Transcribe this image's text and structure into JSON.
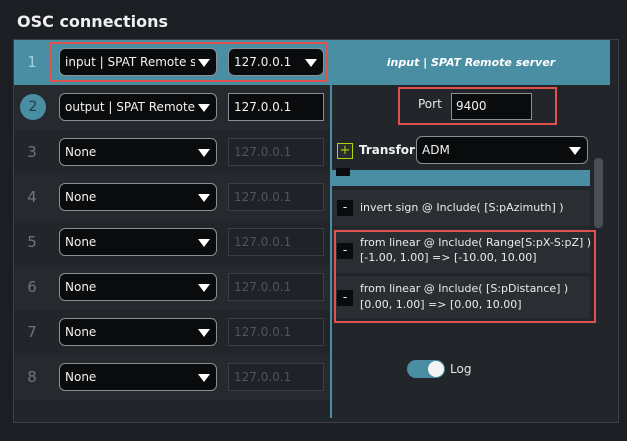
{
  "title": "OSC connections",
  "connections": [
    {
      "num": "1",
      "type": "input | SPAT Remote server",
      "ip": "127.0.0.1",
      "selected": true
    },
    {
      "num": "2",
      "type": "output | SPAT Remote server",
      "ip": "127.0.0.1"
    },
    {
      "num": "3",
      "type": "None",
      "ip": "127.0.0.1"
    },
    {
      "num": "4",
      "type": "None",
      "ip": "127.0.0.1"
    },
    {
      "num": "5",
      "type": "None",
      "ip": "127.0.0.1"
    },
    {
      "num": "6",
      "type": "None",
      "ip": "127.0.0.1"
    },
    {
      "num": "7",
      "type": "None",
      "ip": "127.0.0.1"
    },
    {
      "num": "8",
      "type": "None",
      "ip": "127.0.0.1"
    }
  ],
  "detail": {
    "header": "input | SPAT Remote server",
    "port_label": "Port",
    "port_value": "9400",
    "transform_add": "+",
    "transform_label": "Transform:",
    "transform_value": "ADM",
    "transforms": [
      {
        "line1": "invert sign @ Include( [S:pAzimuth] )",
        "line2": ""
      },
      {
        "line1": "from linear @ Include( Range[S:pX-S:pZ] )",
        "line2": "[-1.00, 1.00] => [-10.00, 10.00]"
      },
      {
        "line1": "from linear @ Include( [S:pDistance] )",
        "line2": "[0.00, 1.00] => [0.00, 10.00]"
      }
    ],
    "log_label": "Log",
    "log_on": true
  },
  "colors": {
    "accent": "#4a8ea3",
    "highlight": "#e0524e",
    "plus": "#b6d200"
  }
}
